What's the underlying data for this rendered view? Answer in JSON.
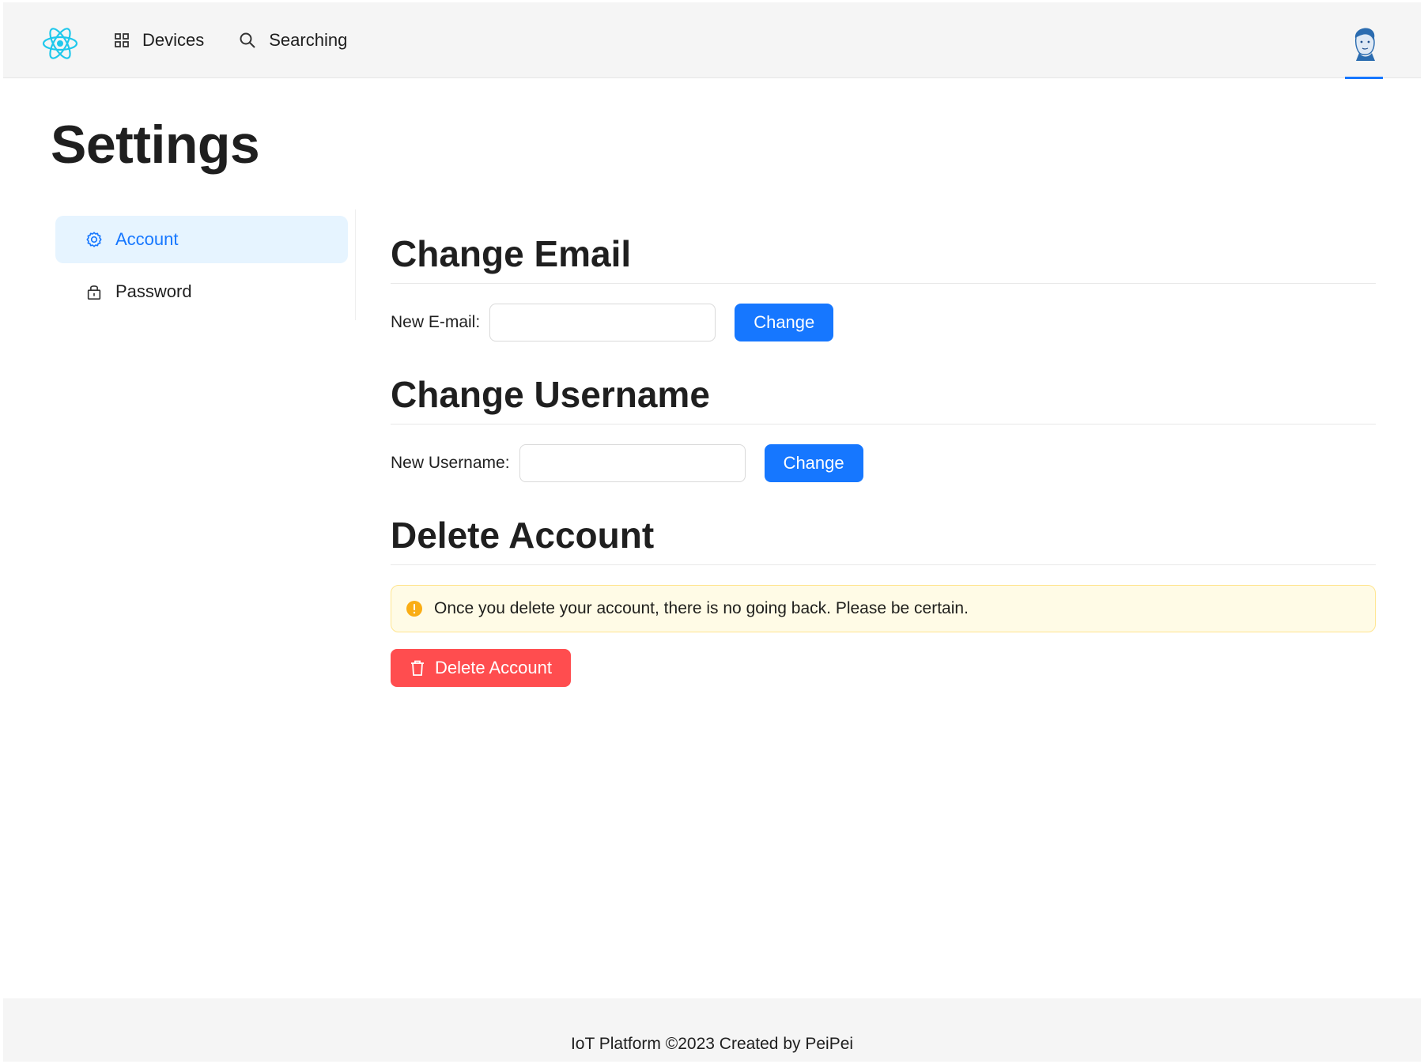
{
  "header": {
    "nav": [
      {
        "label": "Devices",
        "icon": "appstore-icon"
      },
      {
        "label": "Searching",
        "icon": "search-icon"
      }
    ],
    "accent": "#1677ff"
  },
  "page": {
    "title": "Settings"
  },
  "side_menu": {
    "items": [
      {
        "label": "Account",
        "icon": "gear-icon",
        "active": true
      },
      {
        "label": "Password",
        "icon": "lock-icon",
        "active": false
      }
    ]
  },
  "sections": {
    "email": {
      "title": "Change Email",
      "label": "New E-mail",
      "colon": ":",
      "value": "",
      "button": "Change"
    },
    "username": {
      "title": "Change Username",
      "label": "New Username",
      "colon": ":",
      "value": "",
      "button": "Change"
    },
    "delete": {
      "title": "Delete Account",
      "warning": "Once you delete your account, there is no going back. Please be certain.",
      "button": "Delete Account"
    }
  },
  "footer": {
    "text": "IoT Platform ©2023 Created by PeiPei"
  },
  "colors": {
    "primary": "#1677ff",
    "danger": "#ff4d4f",
    "warning": "#faad14"
  }
}
